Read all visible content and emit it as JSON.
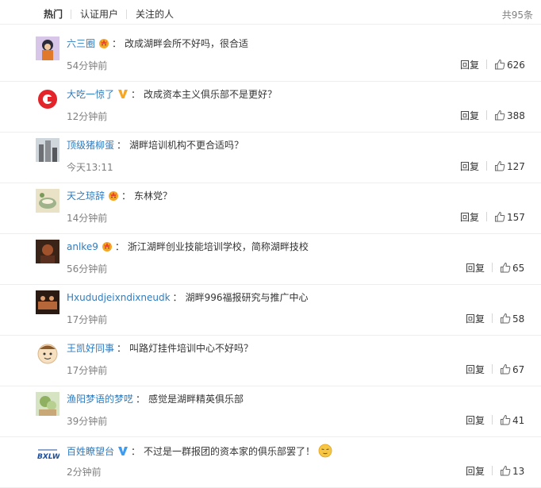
{
  "tabs": [
    {
      "label": "热门",
      "active": true
    },
    {
      "label": "认证用户",
      "active": false
    },
    {
      "label": "关注的人",
      "active": false
    }
  ],
  "total": "共95条",
  "reply_label": "回复",
  "comments": [
    {
      "user": "六三圈",
      "badge": "crown-badge",
      "text": "改成湖畔会所不好吗，很合适",
      "time": "54分钟前",
      "likes": "626"
    },
    {
      "user": "大吃一惊了",
      "badge": "v-badge",
      "text": "改成资本主义俱乐部不是更好？",
      "time": "12分钟前",
      "likes": "388"
    },
    {
      "user": "顶级猪柳蛋",
      "badge": "",
      "text": "湖畔培训机构不更合适吗？",
      "time": "今天13:11",
      "likes": "127"
    },
    {
      "user": "天之琼辞",
      "badge": "crown-badge",
      "text": "东林党？",
      "time": "14分钟前",
      "likes": "157"
    },
    {
      "user": "anlke9",
      "badge": "crown-badge",
      "text": "浙江湖畔创业技能培训学校，简称湖畔技校",
      "time": "56分钟前",
      "likes": "65"
    },
    {
      "user": "Hxududjeixndixneudk",
      "badge": "",
      "text": "湖畔996福报研究与推广中心",
      "time": "17分钟前",
      "likes": "58"
    },
    {
      "user": "王凯好同事",
      "badge": "",
      "text": "叫路灯挂件培训中心不好吗？",
      "time": "17分钟前",
      "likes": "67"
    },
    {
      "user": "渔阳梦语的梦呓",
      "badge": "",
      "text": "感觉是湖畔精英俱乐部",
      "time": "39分钟前",
      "likes": "41"
    },
    {
      "user": "百姓瞭望台",
      "badge": "v-badge",
      "text": "不过是一群报团的资本家的俱乐部罢了！",
      "time": "2分钟前",
      "likes": "13",
      "emoji": "smirk-emoji"
    }
  ],
  "colors": {
    "link": "#2f7cc0",
    "muted": "#808080",
    "badge_gold": "#f5a623",
    "v_blue": "#3d9cf0"
  }
}
